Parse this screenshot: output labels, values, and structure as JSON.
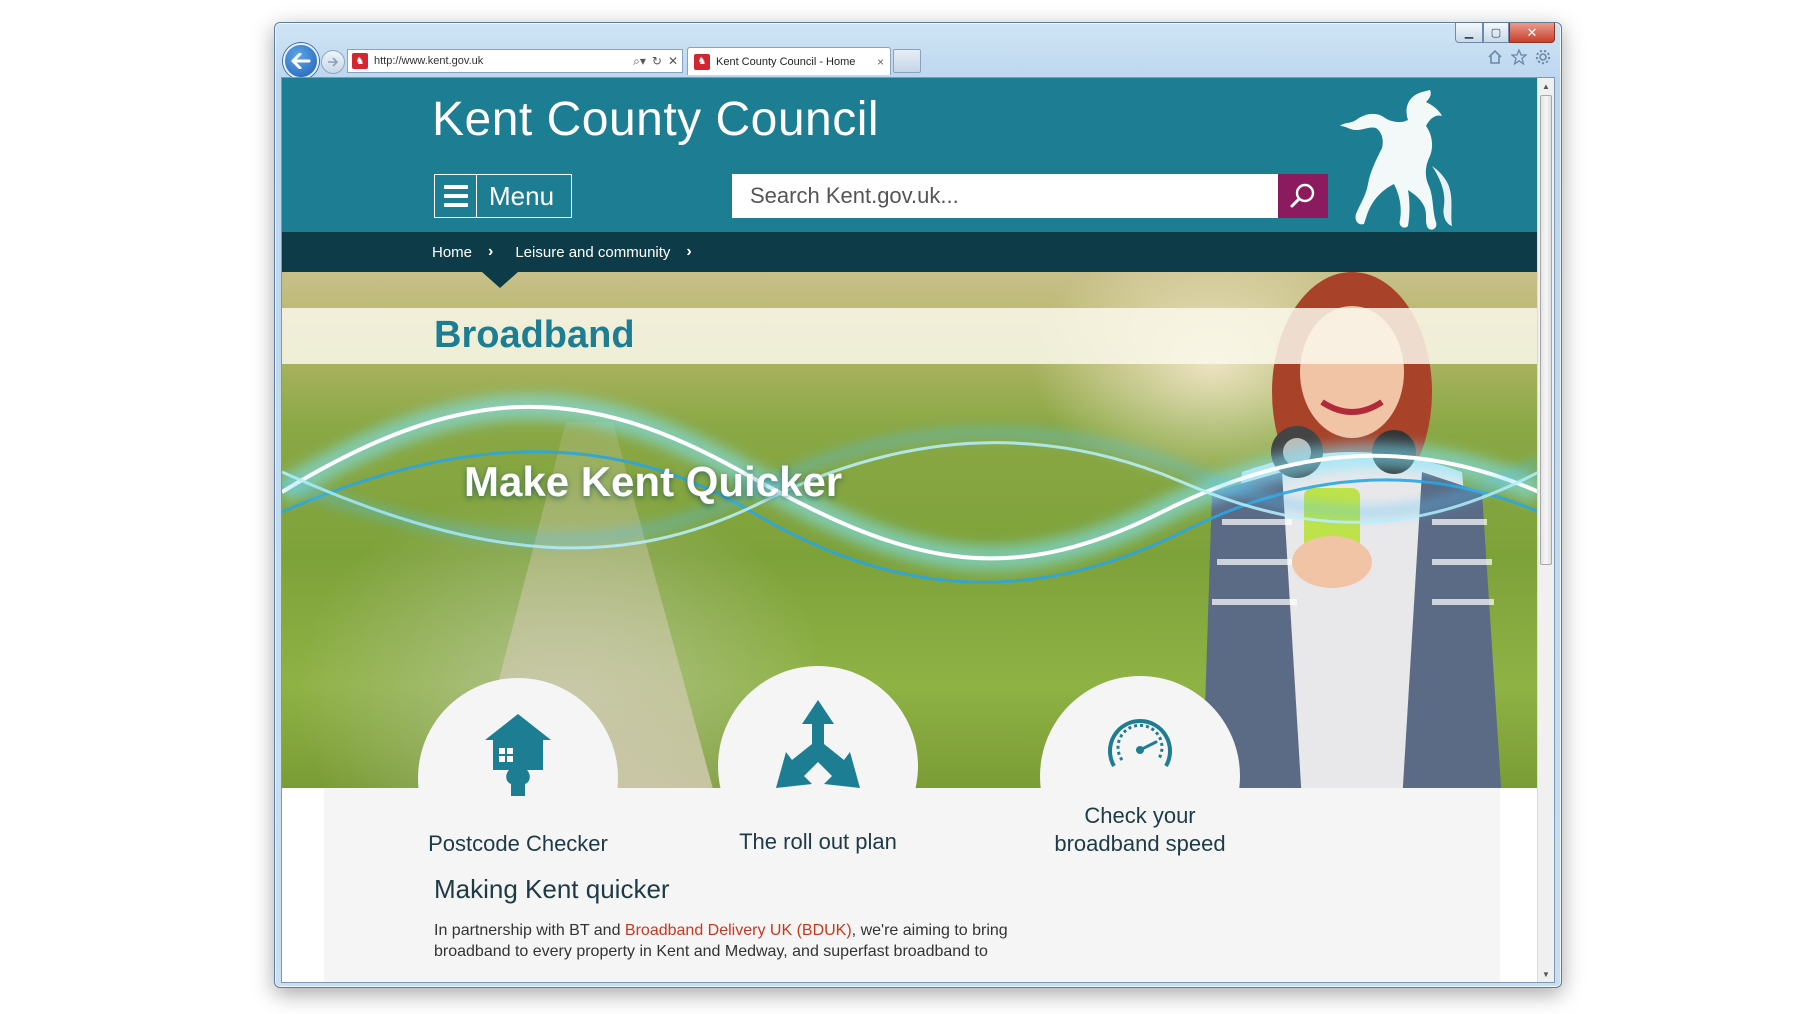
{
  "browser": {
    "address": "http://www.kent.gov.uk",
    "tab_title": "Kent County Council - Home",
    "tab_close": "×",
    "window_controls": {
      "minimize": "▁",
      "maximize": "▢",
      "close": "✕"
    }
  },
  "header": {
    "site_title": "Kent County Council",
    "menu_label": "Menu",
    "search_placeholder": "Search Kent.gov.uk..."
  },
  "breadcrumb": [
    {
      "label": "Home"
    },
    {
      "label": "Leisure and community"
    }
  ],
  "hero": {
    "page_title": "Broadband",
    "heading": "Make Kent Quicker"
  },
  "services": [
    {
      "label": "Postcode Checker",
      "icon": "house-puzzle-icon"
    },
    {
      "label": "The roll out plan",
      "icon": "arrows-triangle-icon"
    },
    {
      "label_line1": "Check your",
      "label_line2": "broadband speed",
      "icon": "speedometer-icon"
    }
  ],
  "content": {
    "heading": "Making Kent quicker",
    "para_prefix": "In partnership with BT and ",
    "para_link": "Broadband Delivery UK (BDUK)",
    "para_suffix": ", we're aiming to bring broadband to every property in Kent and Medway, and superfast broadband to"
  },
  "colors": {
    "header_teal": "#1d7d92",
    "breadcrumb_navy": "#0d3b48",
    "search_button_plum": "#8b1a5e",
    "link_red": "#c8381e"
  }
}
